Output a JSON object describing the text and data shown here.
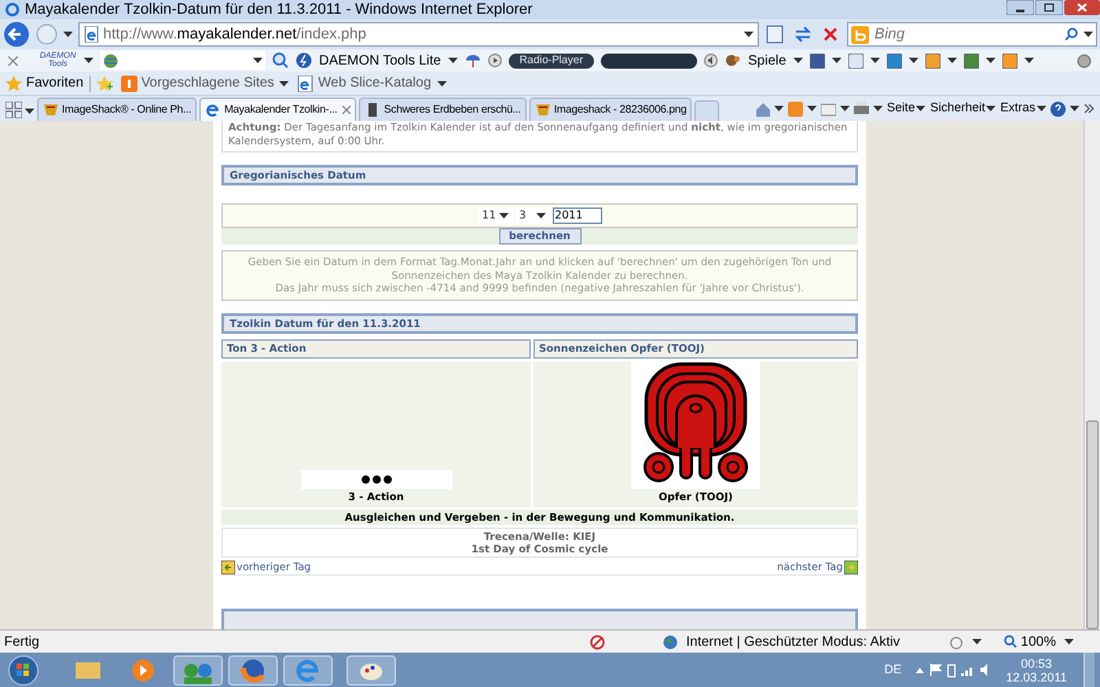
{
  "window": {
    "title": "Mayakalender Tzolkin-Datum für den 11.3.2011 - Windows Internet Explorer"
  },
  "address_bar": {
    "url_start": "http://www.",
    "url_domain": "mayakalender.net",
    "url_end": "/index.php"
  },
  "search": {
    "placeholder": "Bing"
  },
  "toolbar": {
    "logo": "DAEMON Tools",
    "product": "DAEMON Tools Lite",
    "radio": "Radio-Player",
    "games": "Spiele"
  },
  "favorites_bar": {
    "label": "Favoriten",
    "items": [
      "Vorgeschlagene Sites",
      "Web Slice-Katalog"
    ]
  },
  "tabs": [
    {
      "label": "ImageShack® - Online Ph...",
      "selected": false
    },
    {
      "label": "Mayakalender Tzolkin-...",
      "selected": true
    },
    {
      "label": "Schweres Erdbeben erschü...",
      "selected": false
    },
    {
      "label": "Imageshack - 28236006.png",
      "selected": false
    }
  ],
  "command_bar": [
    "Seite",
    "Sicherheit",
    "Extras"
  ],
  "page": {
    "notice": "**Achtung:** Der Tagesanfang im Tzolkin Kalender ist auf den Sonnenaufgang definiert und **nicht**, wie im gregorianischen Kalendersystem, auf 0:00 Uhr.",
    "gregorian": {
      "heading": "Gregorianisches Datum",
      "day": "11",
      "month": "3",
      "year": "2011",
      "button": "berechnen",
      "info": [
        "Geben Sie ein Datum in dem Format Tag.Monat.Jahr an und klicken auf 'berechnen' um den zugehörigen Ton und Sonnenzeichen des Maya Tzolkin Kalender zu berechnen.",
        "Das Jahr muss sich zwischen -4714 and 9999 befinden (negative Jahreszahlen für 'Jahre vor Christus')."
      ]
    },
    "tzolkin": {
      "heading": "Tzolkin Datum für den 11.3.2011",
      "tone_heading": "Ton 3 - Action",
      "tone_caption": "3 - Action",
      "sign_heading": "Sonnenzeichen Opfer (TOOJ)",
      "sign_caption": "Opfer (TOOJ)",
      "meaning": "Ausgleichen und Vergeben - in der Bewegung und Kommunikation.",
      "trecena": [
        "Trecena/Welle: KIEJ",
        "1st Day of Cosmic cycle"
      ],
      "previous": "vorheriger Tag",
      "next": "nächster Tag"
    }
  },
  "status_bar": {
    "text": "Fertig",
    "zone": "Internet | Geschützter Modus: Aktiv",
    "zoom": "100%"
  },
  "taskbar": {
    "language": "DE",
    "time": "00:53",
    "date": "12.03.2011"
  }
}
